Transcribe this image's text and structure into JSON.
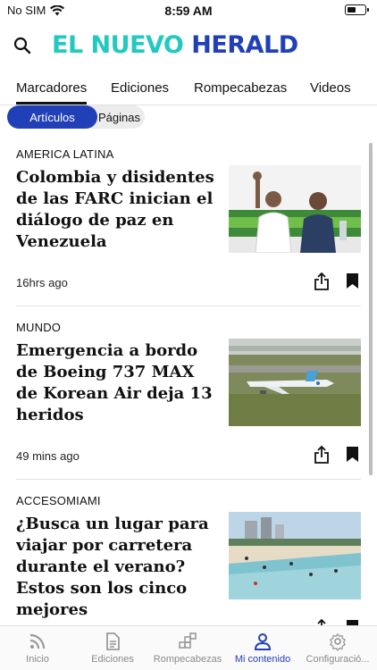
{
  "status_bar": {
    "carrier": "No SIM",
    "time": "8:59 AM"
  },
  "header": {
    "logo_part1": "EL NUEVO ",
    "logo_part2": "HERALD"
  },
  "tabs": [
    {
      "label": "Marcadores",
      "active": true
    },
    {
      "label": "Ediciones",
      "active": false
    },
    {
      "label": "Rompecabezas",
      "active": false
    },
    {
      "label": "Videos",
      "active": false
    }
  ],
  "filters": [
    {
      "label": "Artículos",
      "active": true
    },
    {
      "label": "Páginas",
      "active": false
    }
  ],
  "articles": [
    {
      "category": "AMERICA LATINA",
      "headline": "Colombia y disidentes de las FARC inician el diálogo de paz en Venezuela",
      "time": "16hrs ago"
    },
    {
      "category": "MUNDO",
      "headline": "Emergencia a bordo de Boeing 737 MAX de Korean Air deja 13 heridos",
      "time": "49 mins ago"
    },
    {
      "category": "ACCESOMIAMI",
      "headline": "¿Busca un lugar para viajar por carretera durante el verano? Estos son los cinco mejores",
      "time": ""
    }
  ],
  "bottom_nav": [
    {
      "label": "Inicio",
      "icon": "rss-icon",
      "active": false
    },
    {
      "label": "Ediciones",
      "icon": "document-icon",
      "active": false
    },
    {
      "label": "Rompecabezas",
      "icon": "puzzle-icon",
      "active": false
    },
    {
      "label": "Mi contenido",
      "icon": "person-icon",
      "active": true
    },
    {
      "label": "Configuració...",
      "icon": "gear-icon",
      "active": false
    }
  ],
  "colors": {
    "brand_teal": "#21c9c0",
    "brand_blue": "#2140b8"
  }
}
